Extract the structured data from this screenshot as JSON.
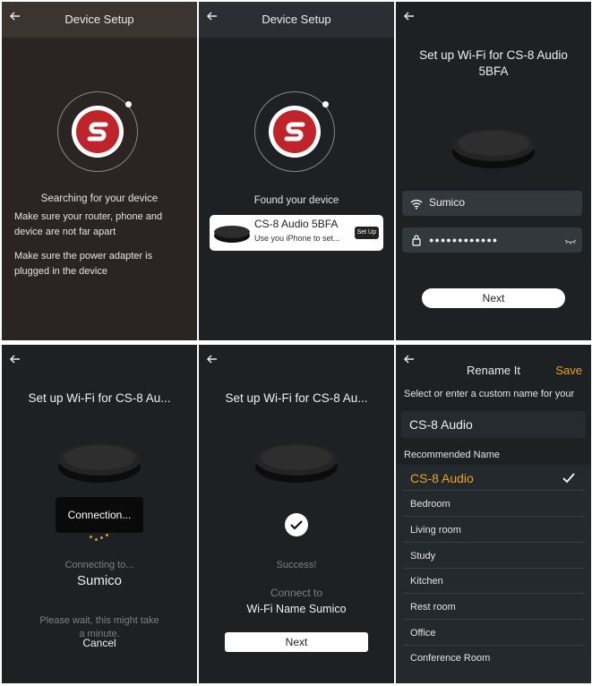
{
  "screen1": {
    "title": "Device Setup",
    "line1": "Searching for your device",
    "line2": "Make sure your router, phone and",
    "line3": "device are not far apart",
    "line4": "Make sure the power adapter is",
    "line5": "plugged in the device"
  },
  "screen2": {
    "title": "Device Setup",
    "found": "Found your device",
    "device_name": "CS-8 Audio 5BFA",
    "device_sub": "Use you iPhone to set...",
    "setup_button": "Set Up"
  },
  "screen3": {
    "title_line1": "Set up Wi-Fi for CS-8 Audio",
    "title_line2": "5BFA",
    "wifi_name": "Sumico",
    "password_mask": "●●●●●●●●●●●●",
    "next_button": "Next"
  },
  "screen4": {
    "title": "Set up Wi-Fi for CS-8 Au...",
    "toast": "Connection...",
    "connecting": "Connecting to...",
    "network": "Sumico",
    "wait_line1": "Please wait, this might take",
    "wait_line2": "a minute.",
    "cancel": "Cancel"
  },
  "screen5": {
    "title": "Set up Wi-Fi for CS-8 Au...",
    "success": "Success!",
    "connect_to": "Connect to",
    "wifi_line": "Wi-Fi Name Sumico",
    "next_button": "Next"
  },
  "screen6": {
    "title": "Rename It",
    "save": "Save",
    "prompt": "Select or enter a custom name for your",
    "name_value": "CS-8 Audio",
    "recommended_label": "Recommended Name",
    "options": [
      "CS-8 Audio",
      "Bedroom",
      "Living room",
      "Study",
      "Kitchen",
      "Rest room",
      "Office",
      "Conference Room"
    ]
  },
  "colors": {
    "accent": "#f0a020",
    "logo_red": "#c0242b",
    "bg_dark": "#1d2124"
  }
}
